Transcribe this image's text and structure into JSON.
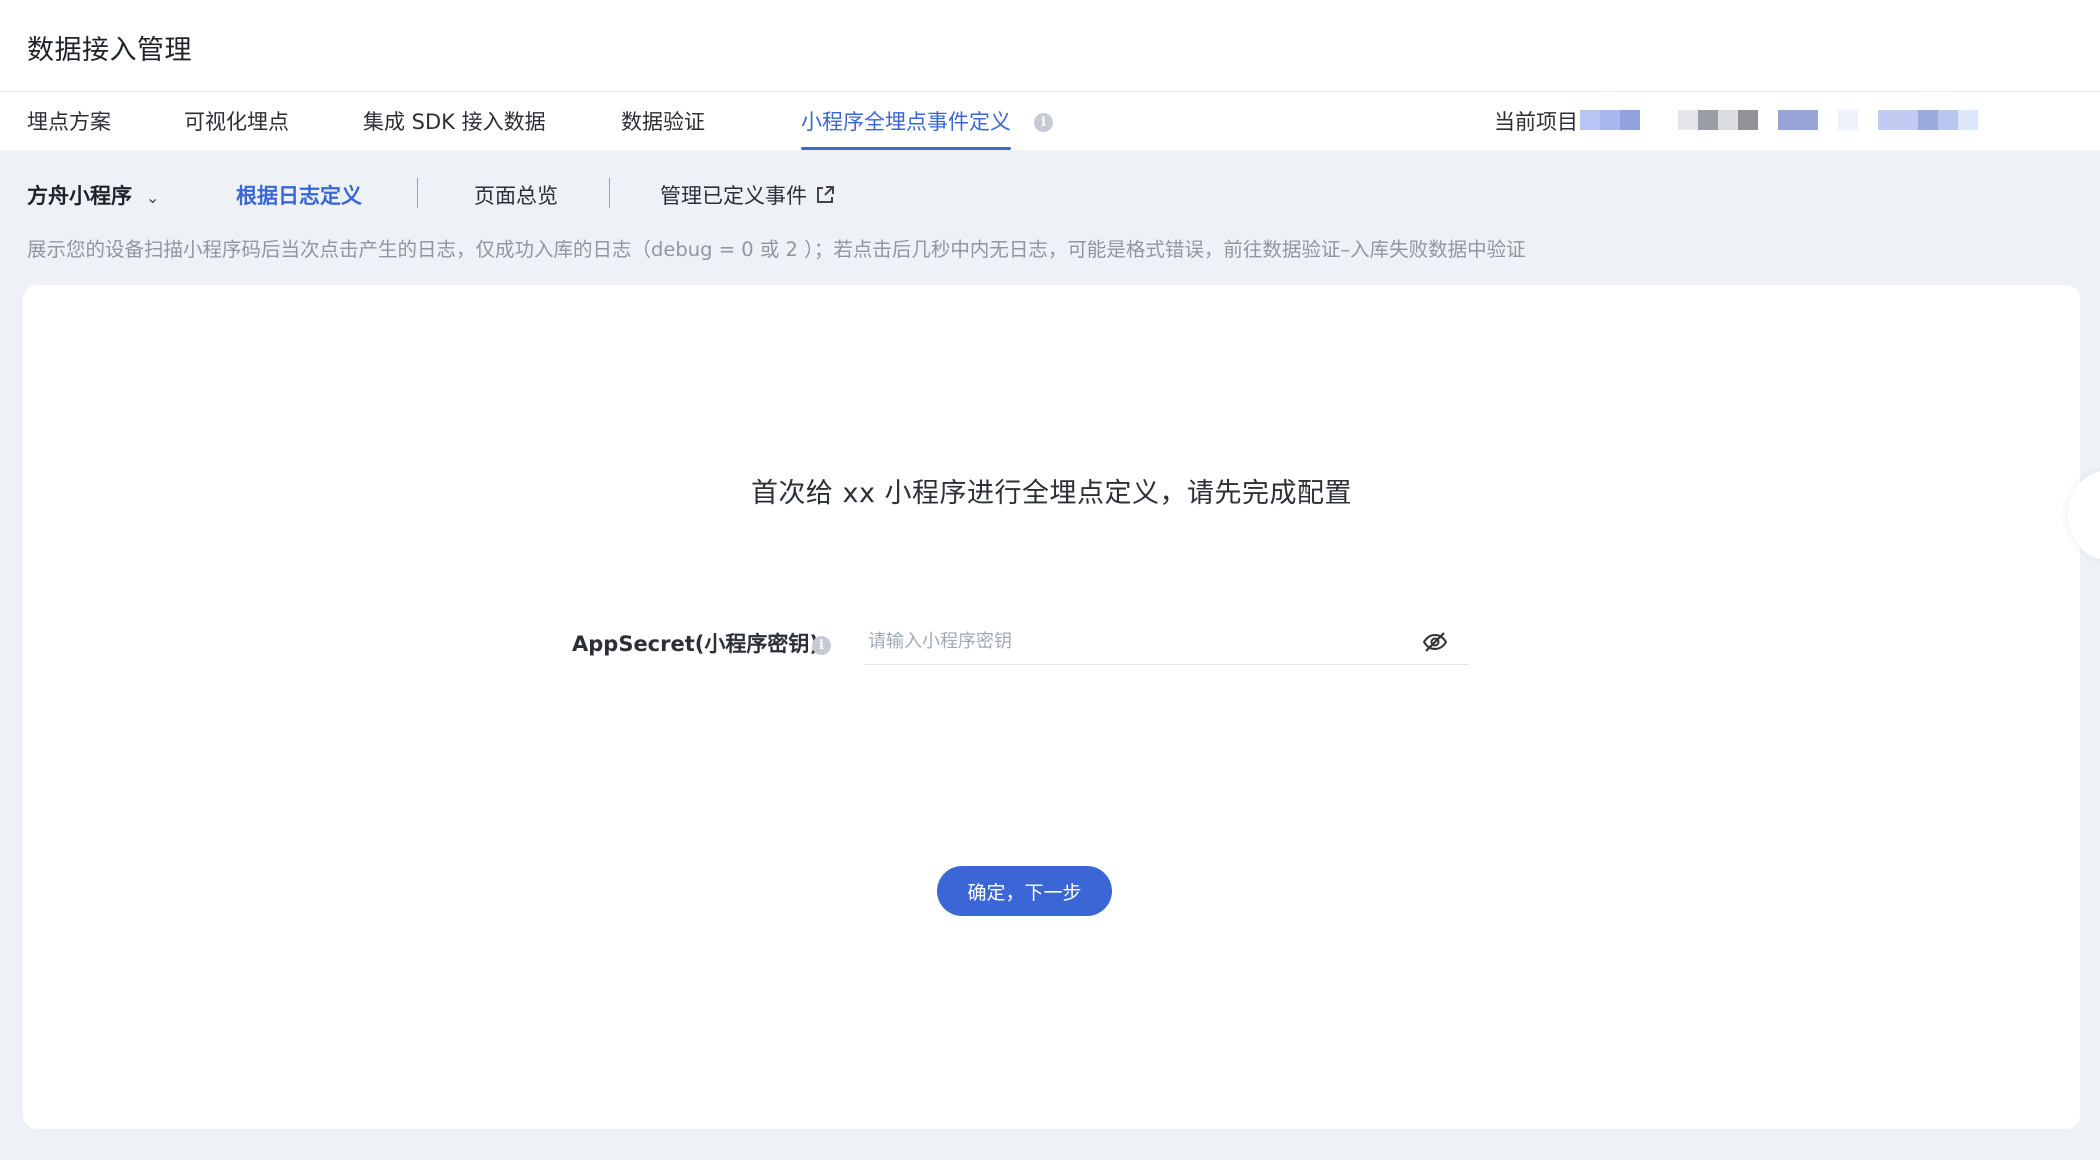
{
  "header": {
    "title": "数据接入管理"
  },
  "tabs": [
    {
      "label": "埋点方案"
    },
    {
      "label": "可视化埋点"
    },
    {
      "label": "集成 SDK 接入数据"
    },
    {
      "label": "数据验证"
    },
    {
      "label": "小程序全埋点事件定义",
      "active": true
    }
  ],
  "project": {
    "label": "当前项目",
    "blur_colors": [
      "#b9c3f4",
      "#a8b8ef",
      "#8fa2dc",
      "#ffffff",
      "#e3e5ea",
      "#9a9ca3",
      "#dcdde1",
      "#909298",
      "#ffffff",
      "#98a4d8",
      "#ffffff",
      "#eef1fb",
      "#ffffff",
      "#c4cbf3",
      "#9aa9dc",
      "#b7c6ef",
      "#dce6f7"
    ]
  },
  "subnav": {
    "app_select": "方舟小程序",
    "items": [
      {
        "label": "根据日志定义",
        "active": true
      },
      {
        "label": "页面总览"
      },
      {
        "label": "管理已定义事件"
      }
    ]
  },
  "description": "展示您的设备扫描小程序码后当次点击产生的日志，仅成功入库的日志（debug = 0 或 2 ）；若点击后几秒中内无日志，可能是格式错误，前往数据验证–入库失败数据中验证",
  "card": {
    "title": "首次给 xx 小程序进行全埋点定义，请先完成配置",
    "form": {
      "label": "AppSecret(小程序密钥)",
      "placeholder": "请输入小程序密钥",
      "value": ""
    },
    "submit_label": "确定，下一步"
  },
  "colors": {
    "accent": "#3a66d6",
    "background": "#eef2f6"
  },
  "icons": {
    "info": "info-icon",
    "dropdown": "chevron-down-icon",
    "external": "external-link-icon",
    "visibility": "eye-off-icon"
  }
}
